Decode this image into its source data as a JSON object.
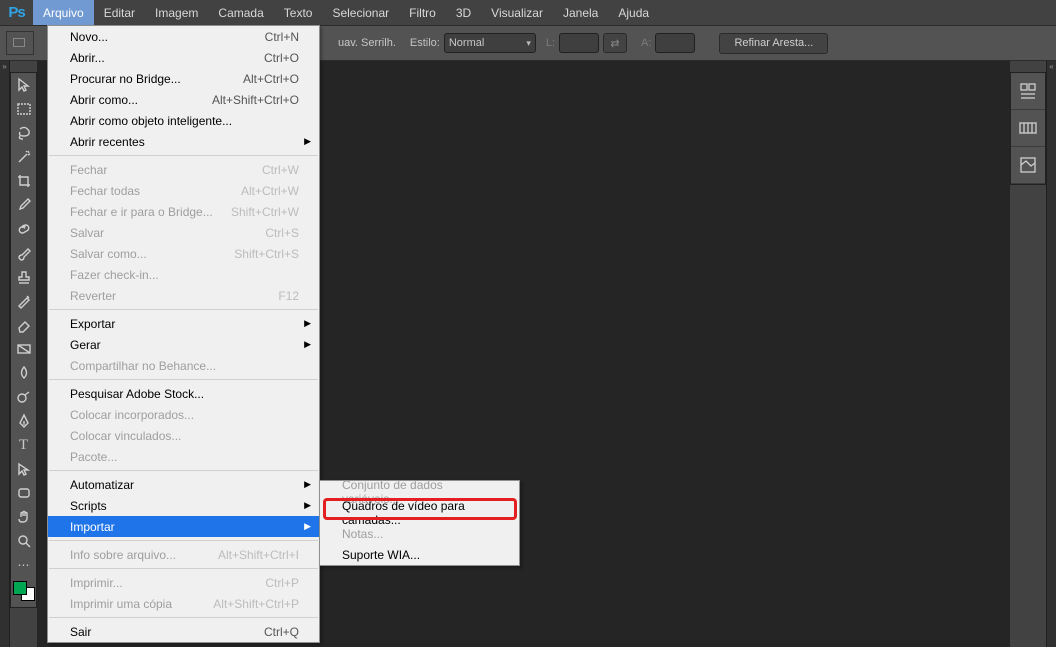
{
  "logo": "Ps",
  "menubar": [
    "Arquivo",
    "Editar",
    "Imagem",
    "Camada",
    "Texto",
    "Selecionar",
    "Filtro",
    "3D",
    "Visualizar",
    "Janela",
    "Ajuda"
  ],
  "activeMenuIndex": 0,
  "optionsBar": {
    "suavLabel": "uav. Serrilh.",
    "estiloLabel": "Estilo:",
    "estiloValue": "Normal",
    "LLabel": "L:",
    "ALabel": "A:",
    "refineBtn": "Refinar Aresta..."
  },
  "fileMenu": [
    {
      "label": "Novo...",
      "shortcut": "Ctrl+N"
    },
    {
      "label": "Abrir...",
      "shortcut": "Ctrl+O"
    },
    {
      "label": "Procurar no Bridge...",
      "shortcut": "Alt+Ctrl+O"
    },
    {
      "label": "Abrir como...",
      "shortcut": "Alt+Shift+Ctrl+O"
    },
    {
      "label": "Abrir como objeto inteligente..."
    },
    {
      "label": "Abrir recentes",
      "submenu": true
    },
    {
      "sep": true
    },
    {
      "label": "Fechar",
      "shortcut": "Ctrl+W",
      "disabled": true
    },
    {
      "label": "Fechar todas",
      "shortcut": "Alt+Ctrl+W",
      "disabled": true
    },
    {
      "label": "Fechar e ir para o Bridge...",
      "shortcut": "Shift+Ctrl+W",
      "disabled": true
    },
    {
      "label": "Salvar",
      "shortcut": "Ctrl+S",
      "disabled": true
    },
    {
      "label": "Salvar como...",
      "shortcut": "Shift+Ctrl+S",
      "disabled": true
    },
    {
      "label": "Fazer check-in...",
      "disabled": true
    },
    {
      "label": "Reverter",
      "shortcut": "F12",
      "disabled": true
    },
    {
      "sep": true
    },
    {
      "label": "Exportar",
      "submenu": true
    },
    {
      "label": "Gerar",
      "submenu": true
    },
    {
      "label": "Compartilhar no Behance...",
      "disabled": true
    },
    {
      "sep": true
    },
    {
      "label": "Pesquisar Adobe Stock..."
    },
    {
      "label": "Colocar incorporados...",
      "disabled": true
    },
    {
      "label": "Colocar vinculados...",
      "disabled": true
    },
    {
      "label": "Pacote...",
      "disabled": true
    },
    {
      "sep": true
    },
    {
      "label": "Automatizar",
      "submenu": true
    },
    {
      "label": "Scripts",
      "submenu": true
    },
    {
      "label": "Importar",
      "submenu": true,
      "highlight": true
    },
    {
      "sep": true
    },
    {
      "label": "Info sobre arquivo...",
      "shortcut": "Alt+Shift+Ctrl+I",
      "disabled": true
    },
    {
      "sep": true
    },
    {
      "label": "Imprimir...",
      "shortcut": "Ctrl+P",
      "disabled": true
    },
    {
      "label": "Imprimir uma cópia",
      "shortcut": "Alt+Shift+Ctrl+P",
      "disabled": true
    },
    {
      "sep": true
    },
    {
      "label": "Sair",
      "shortcut": "Ctrl+Q"
    }
  ],
  "importSubmenu": [
    {
      "label": "Conjunto de dados variáveis...",
      "disabled": true
    },
    {
      "label": "Quadros de vídeo para camadas...",
      "highlightBox": true
    },
    {
      "label": "Notas...",
      "disabled": true
    },
    {
      "label": "Suporte WIA..."
    }
  ],
  "tools": [
    "move",
    "marquee",
    "lasso",
    "wand",
    "crop",
    "eyedropper",
    "healing",
    "brush",
    "stamp",
    "history",
    "eraser",
    "gradient",
    "blur",
    "dodge",
    "pen",
    "type",
    "path",
    "shape",
    "hand",
    "zoom"
  ],
  "rightPanels": [
    "history",
    "color",
    "libraries"
  ]
}
